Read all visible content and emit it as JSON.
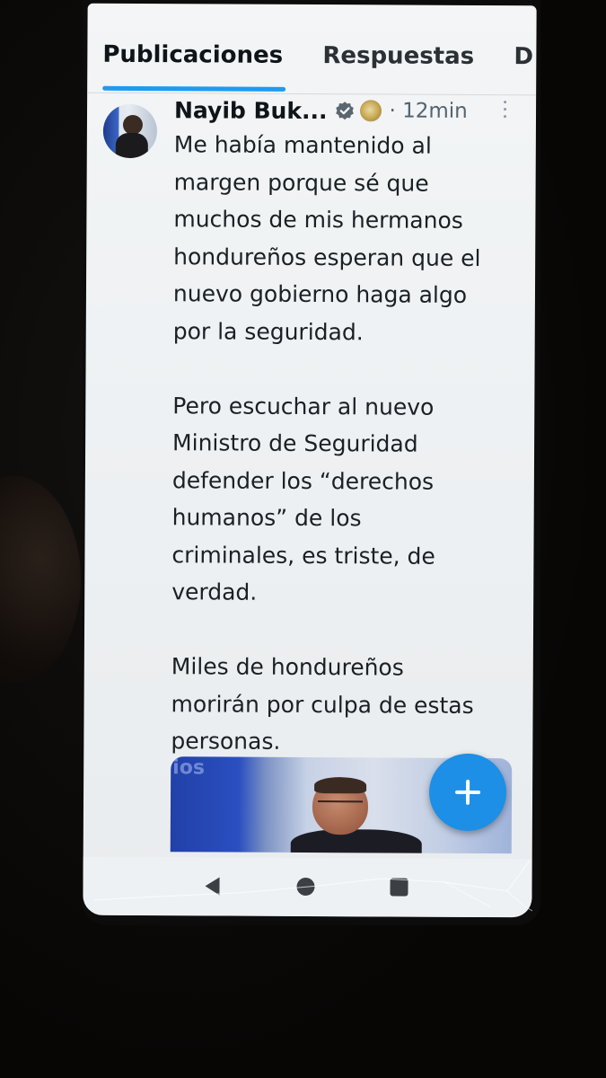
{
  "profile_tabs": {
    "items": [
      {
        "label": "Publicaciones",
        "selected": true
      },
      {
        "label": "Respuestas",
        "selected": false
      },
      {
        "label": "D",
        "selected": false
      }
    ],
    "accent_color": "#1d9bf0"
  },
  "post": {
    "author": "Nayib Buk...",
    "verified_icon": "verified-badge-icon",
    "affiliation_icon": "government-seal-icon",
    "time": "· 12min",
    "text": "Me había mantenido al\nmargen porque sé que\nmuchos de mis hermanos\nhondureños esperan que el\nnuevo gobierno haga algo\npor la seguridad.\n\nPero escuchar al nuevo\nMinistro de Seguridad\ndefender los “derechos\nhumanos” de los\ncriminales, es triste, de\nverdad.\n\nMiles de hondureños\nmorirán por culpa de estas\npersonas.",
    "media": {
      "logo_text": "ios"
    }
  },
  "fab": {
    "icon": "plus-icon",
    "label": "+",
    "color": "#1d8fe6"
  },
  "system_nav": {
    "back_icon": "back-triangle-icon",
    "home_icon": "home-circle-icon",
    "recents_icon": "recents-square-icon"
  }
}
